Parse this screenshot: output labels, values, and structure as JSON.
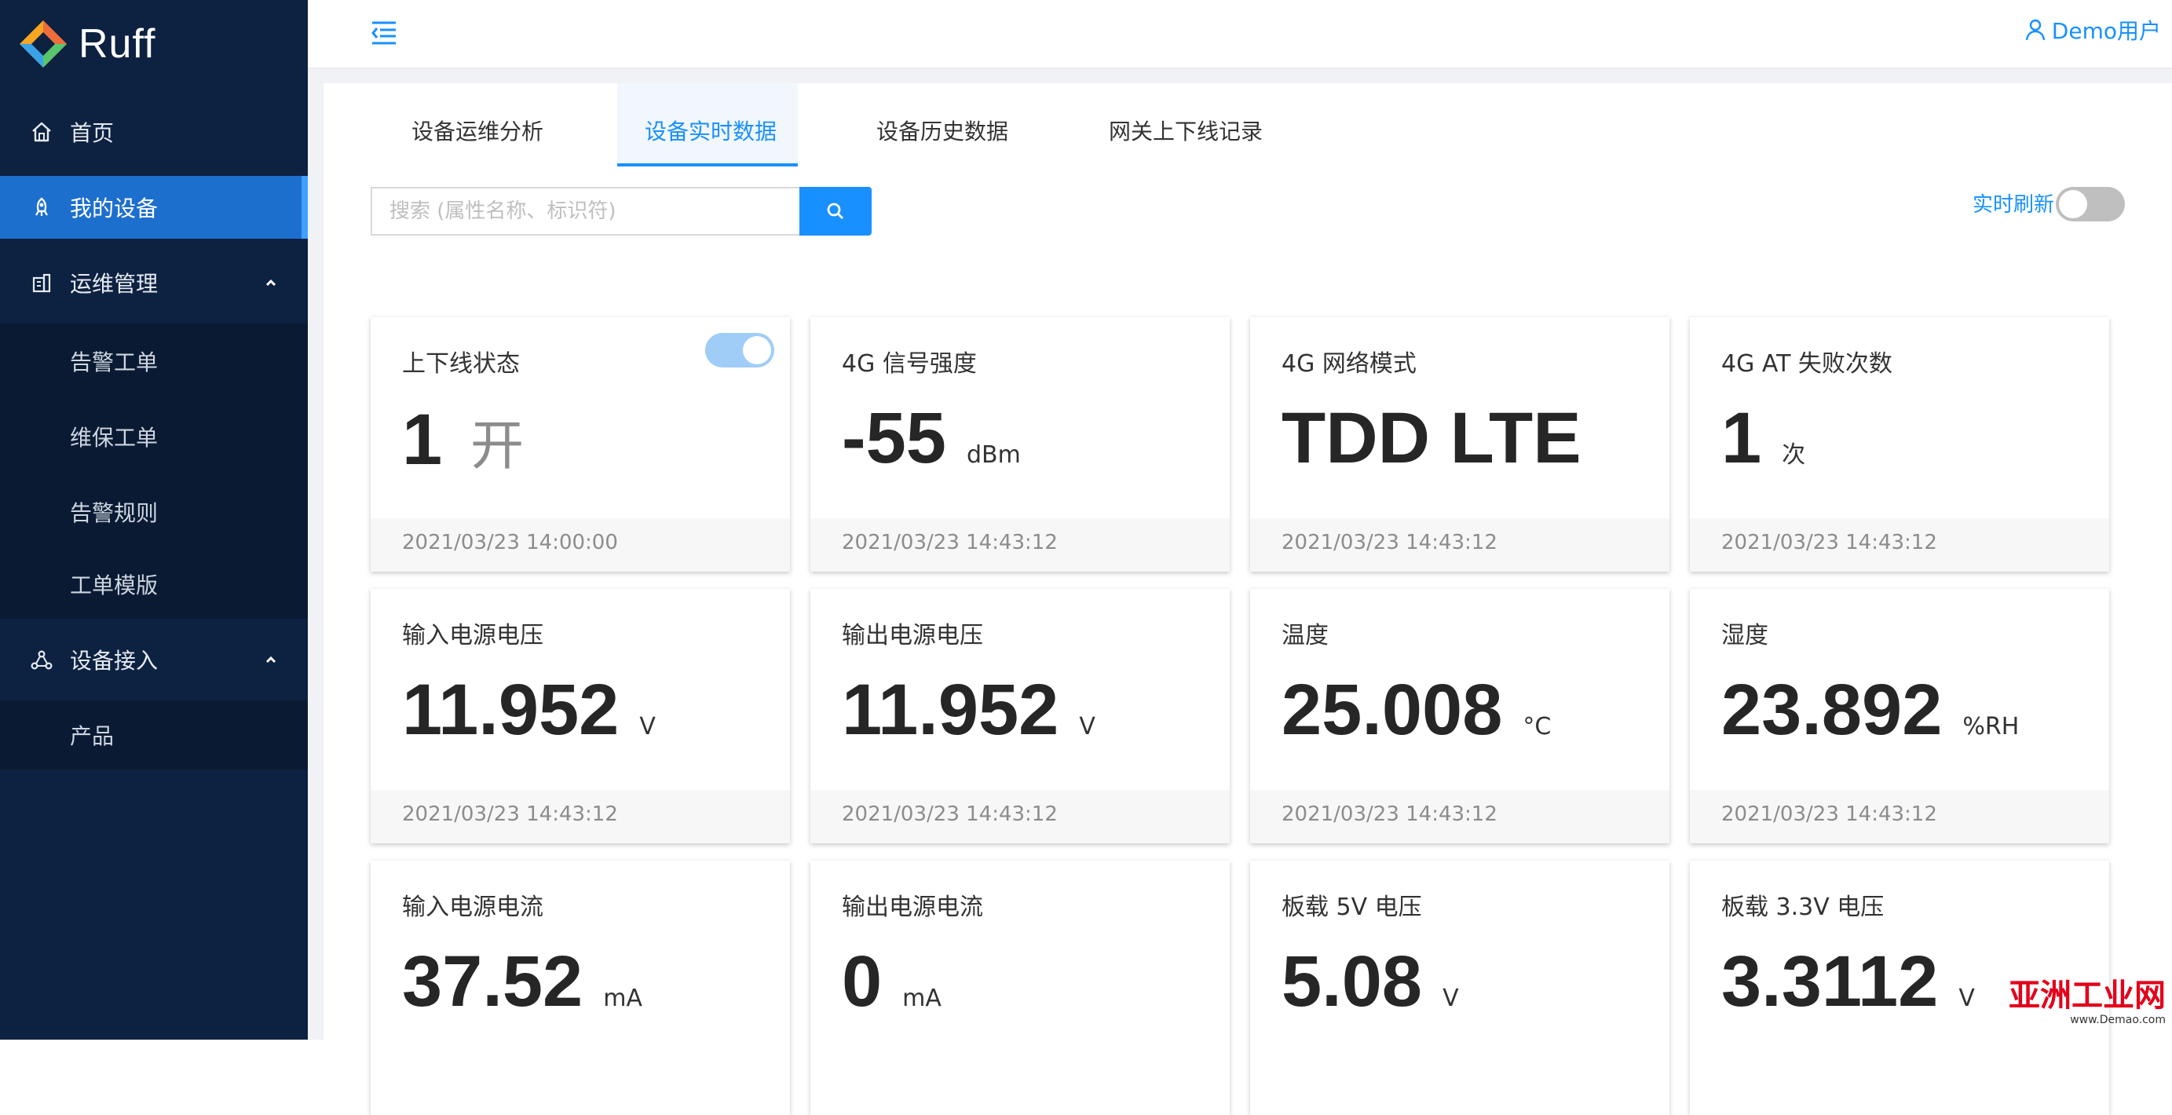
{
  "app": {
    "logo_text": "Ruff"
  },
  "sidebar": {
    "items": [
      {
        "label": "首页",
        "icon": "home-icon"
      },
      {
        "label": "我的设备",
        "icon": "rocket-icon",
        "active": true
      },
      {
        "label": "运维管理",
        "icon": "building-icon",
        "expanded": true
      },
      {
        "label": "告警工单"
      },
      {
        "label": "维保工单"
      },
      {
        "label": "告警规则"
      },
      {
        "label": "工单模版"
      },
      {
        "label": "设备接入",
        "icon": "cluster-icon",
        "expanded": true
      },
      {
        "label": "产品"
      }
    ]
  },
  "header": {
    "user": "Demo用户"
  },
  "tabs": [
    {
      "label": "设备运维分析"
    },
    {
      "label": "设备实时数据",
      "active": true
    },
    {
      "label": "设备历史数据"
    },
    {
      "label": "网关上下线记录"
    }
  ],
  "search": {
    "placeholder": "搜索 (属性名称、标识符)"
  },
  "refresh": {
    "label": "实时刷新",
    "on": false
  },
  "cards": [
    {
      "title": "上下线状态",
      "value": "1",
      "unit": "开",
      "time": "2021/03/23 14:00:00",
      "toggle": true
    },
    {
      "title": "4G 信号强度",
      "value": "-55",
      "unit": "dBm",
      "time": "2021/03/23 14:43:12"
    },
    {
      "title": "4G 网络模式",
      "value": "TDD LTE",
      "unit": "",
      "time": "2021/03/23 14:43:12"
    },
    {
      "title": "4G AT 失败次数",
      "value": "1",
      "unit": "次",
      "time": "2021/03/23 14:43:12"
    },
    {
      "title": "输入电源电压",
      "value": "11.952",
      "unit": "V",
      "time": "2021/03/23 14:43:12"
    },
    {
      "title": "输出电源电压",
      "value": "11.952",
      "unit": "V",
      "time": "2021/03/23 14:43:12"
    },
    {
      "title": "温度",
      "value": "25.008",
      "unit": "°C",
      "time": "2021/03/23 14:43:12"
    },
    {
      "title": "湿度",
      "value": "23.892",
      "unit": "%RH",
      "time": "2021/03/23 14:43:12"
    },
    {
      "title": "输入电源电流",
      "value": "37.52",
      "unit": "mA",
      "time": ""
    },
    {
      "title": "输出电源电流",
      "value": "0",
      "unit": "mA",
      "time": ""
    },
    {
      "title": "板载 5V 电压",
      "value": "5.08",
      "unit": "V",
      "time": ""
    },
    {
      "title": "板载 3.3V 电压",
      "value": "3.3112",
      "unit": "V",
      "time": ""
    }
  ],
  "watermark": {
    "text": "亚洲工业网",
    "sub": "www.Demao.com"
  },
  "colors": {
    "sidebar_bg": "#0d2141",
    "accent": "#1890ff",
    "active_nav": "#1d6fce"
  }
}
